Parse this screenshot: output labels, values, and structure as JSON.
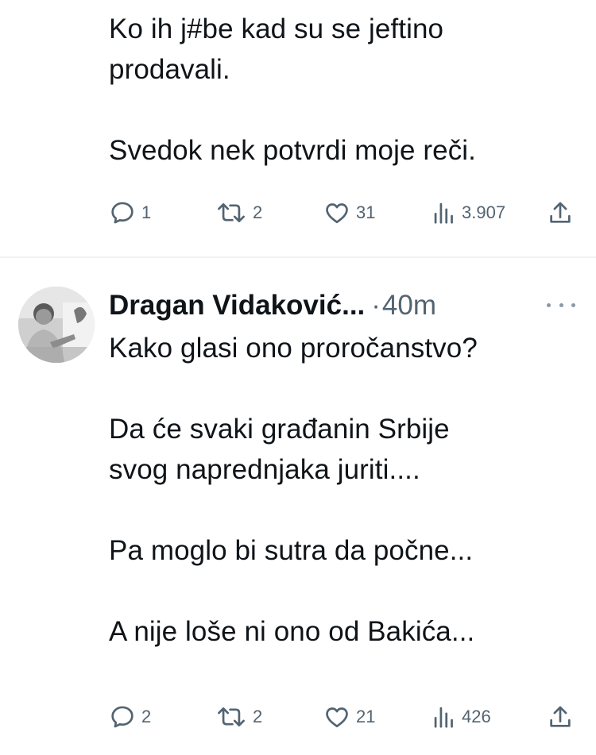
{
  "tweets": [
    {
      "body": "Ko ih j#be kad su se jeftino\nprodavali.\n\nSvedok nek potvrdi moje reči.",
      "actions": {
        "replies": "1",
        "retweets": "2",
        "likes": "31",
        "views": "3.907"
      }
    },
    {
      "author": "Dragan Vidaković...",
      "separator": "·",
      "time": "40m",
      "body": "Kako glasi ono proročanstvo?\n\nDa će svaki građanin Srbije\nsvog naprednjaka juriti....\n\nPa moglo bi sutra da počne...\n\nA nije loše ni ono od Bakića...",
      "actions": {
        "replies": "2",
        "retweets": "2",
        "likes": "21",
        "views": "426"
      }
    }
  ],
  "icons": [
    "reply-icon",
    "retweet-icon",
    "like-icon",
    "views-icon",
    "share-icon",
    "more-icon"
  ],
  "colors": {
    "text": "#0f1419",
    "secondary": "#536471",
    "divider": "#eff3f4"
  }
}
